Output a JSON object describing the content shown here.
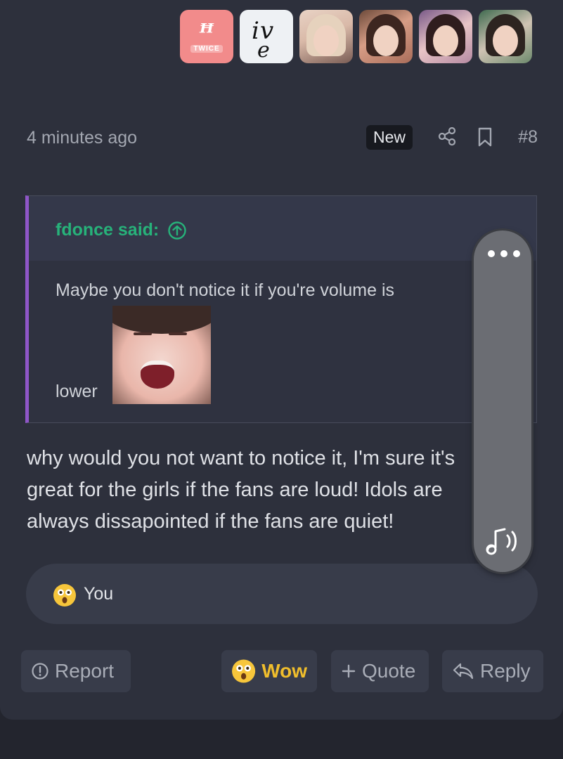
{
  "avatars": [
    {
      "name": "twice-avatar",
      "logo_text": "TW",
      "sub_text": "TWICE"
    },
    {
      "name": "ive-avatar",
      "logo_text": "IVE"
    },
    {
      "name": "member-photo-1"
    },
    {
      "name": "member-photo-2"
    },
    {
      "name": "member-photo-3"
    },
    {
      "name": "member-photo-4"
    }
  ],
  "post": {
    "timestamp": "4 minutes ago",
    "new_badge": "New",
    "number": "#8",
    "quote": {
      "author": "fdonce said:",
      "text": "Maybe you don't notice it if you're volume is",
      "text_after_image": "lower"
    },
    "body_lines": [
      "why would you not want to notice it, I'm sure it's",
      "great for the girls if the fans are loud! Idols are",
      "always dissapointed if the fans are quiet!"
    ],
    "reactions": {
      "emoji": "astonished-face",
      "users": "You"
    }
  },
  "actions": {
    "report": "Report",
    "wow": "Wow",
    "quote": "Quote",
    "reply": "Reply"
  },
  "colors": {
    "background": "#23252e",
    "card": "#2d303c",
    "quote_accent": "#8f56c8",
    "quote_author": "#27b27a",
    "wow": "#f0be2c"
  }
}
